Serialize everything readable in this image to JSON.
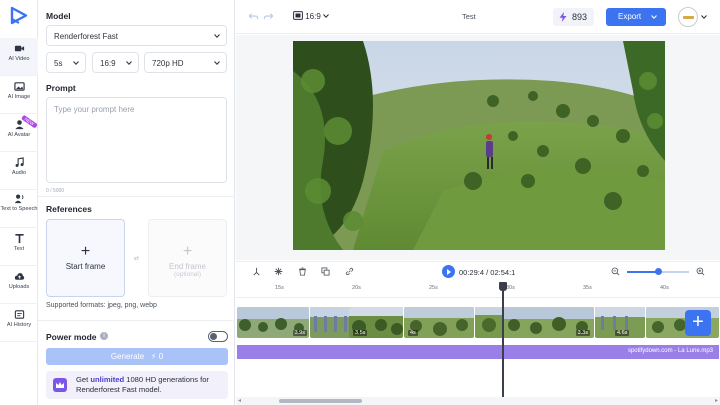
{
  "sidebar": {
    "items": [
      {
        "label": "AI Video",
        "icon": "video-camera-icon",
        "active": true
      },
      {
        "label": "AI Image",
        "icon": "image-icon"
      },
      {
        "label": "AI Avatar",
        "icon": "person-icon",
        "badge": "NEW"
      },
      {
        "label": "Audio",
        "icon": "music-note-icon"
      },
      {
        "label": "Text to Speech",
        "icon": "speech-icon"
      },
      {
        "label": "Text",
        "icon": "text-t-icon"
      },
      {
        "label": "Uploads",
        "icon": "cloud-upload-icon"
      },
      {
        "label": "AI History",
        "icon": "history-icon"
      }
    ]
  },
  "panel": {
    "model_title": "Model",
    "model_value": "Renderforest Fast",
    "duration_value": "5s",
    "ratio_value": "16:9",
    "resolution_value": "720p HD",
    "prompt_title": "Prompt",
    "prompt_placeholder": "Type your prompt here",
    "char_count": "0 / 5000",
    "references_title": "References",
    "start_frame_label": "Start frame",
    "end_frame_label": "End frame",
    "end_frame_optional": "(optional)",
    "supported_formats": "Supported formats: jpeg, png, webp",
    "power_mode_label": "Power mode",
    "generate_label": "Generate",
    "generate_cost": "0",
    "promo_prefix": "Get ",
    "promo_bold": "unlimited",
    "promo_suffix": " 1080 HD generations for",
    "promo_line2": "Renderforest Fast model."
  },
  "topbar": {
    "aspect_ratio": "16:9",
    "project_title": "Test",
    "credits": "893",
    "export_label": "Export"
  },
  "timeline": {
    "current_time": "00:29:4",
    "total_time": "02:54:1",
    "ruler_ticks": [
      "15s",
      "20s",
      "25s",
      "30s",
      "35s",
      "40s"
    ],
    "zoom_level": 0.5,
    "clips": [
      "3.9s",
      "3.5s",
      "4s",
      "6s",
      "3.3s",
      "4.6s"
    ],
    "audio_track": "spotifydown.com - La Lune.mp3"
  },
  "colors": {
    "accent": "#3b73f0",
    "audio_track": "#9b7fe8",
    "promo_icon": "#7b57e6"
  }
}
